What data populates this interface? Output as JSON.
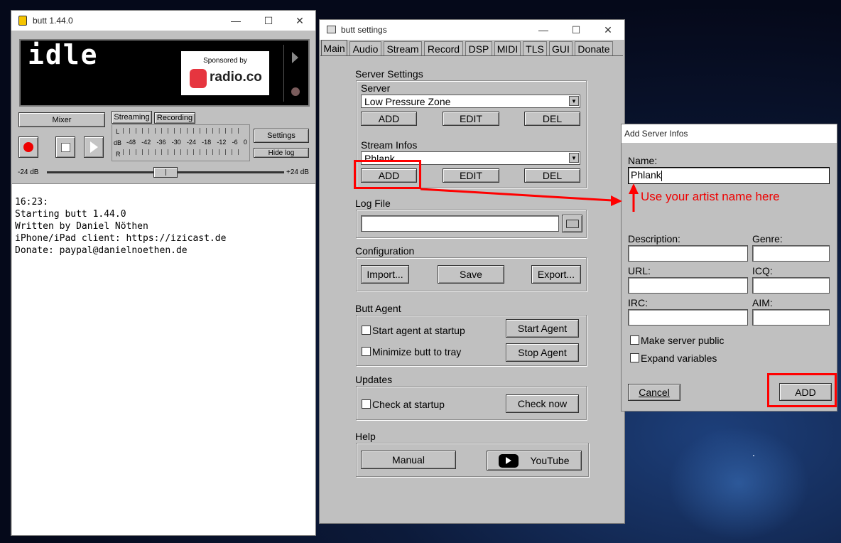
{
  "main_window": {
    "title": "butt 1.44.0",
    "status_text": "idle",
    "sponsor_label": "Sponsored by",
    "sponsor_name": "radio.co",
    "mixer_label": "Mixer",
    "tab_streaming": "Streaming",
    "tab_recording": "Recording",
    "settings_label": "Settings",
    "hidelog_label": "Hide log",
    "meter_channels": [
      "L",
      "dB",
      "R"
    ],
    "meter_ticks": [
      "-48",
      "-42",
      "-36",
      "-30",
      "-24",
      "-18",
      "-12",
      "-6",
      "0"
    ],
    "slider_min": "-24 dB",
    "slider_max": "+24 dB",
    "slider_value": 0.5,
    "log_lines": [
      "16:23:",
      "Starting butt 1.44.0",
      "Written by Daniel Nöthen",
      "iPhone/iPad client: https://izicast.de",
      "Donate: paypal@danielnoethen.de"
    ]
  },
  "settings_window": {
    "title": "butt settings",
    "tabs": [
      "Main",
      "Audio",
      "Stream",
      "Record",
      "DSP",
      "MIDI",
      "TLS",
      "GUI",
      "Donate"
    ],
    "server_settings_label": "Server Settings",
    "server_label": "Server",
    "server_value": "Low Pressure Zone",
    "add_label": "ADD",
    "edit_label": "EDIT",
    "del_label": "DEL",
    "stream_infos_label": "Stream Infos",
    "stream_infos_value": "Phlank",
    "log_file_label": "Log File",
    "log_file_value": "",
    "configuration_label": "Configuration",
    "import_label": "Import...",
    "save_label": "Save",
    "export_label": "Export...",
    "agent_label": "Butt Agent",
    "start_agent_startup_label": "Start agent at startup",
    "minimize_tray_label": "Minimize butt to tray",
    "start_agent_label": "Start Agent",
    "stop_agent_label": "Stop Agent",
    "updates_label": "Updates",
    "check_startup_label": "Check at startup",
    "check_now_label": "Check now",
    "help_label": "Help",
    "manual_label": "Manual",
    "youtube_label": "YouTube"
  },
  "dialog": {
    "title": "Add Server Infos",
    "name_label": "Name:",
    "name_value": "Phlank",
    "description_label": "Description:",
    "genre_label": "Genre:",
    "url_label": "URL:",
    "icq_label": "ICQ:",
    "irc_label": "IRC:",
    "aim_label": "AIM:",
    "make_public_label": "Make server public",
    "expand_vars_label": "Expand variables",
    "cancel_label": "Cancel",
    "add_label": "ADD"
  },
  "annotation": {
    "text": "Use your artist name here",
    "color": "#ff0000"
  }
}
